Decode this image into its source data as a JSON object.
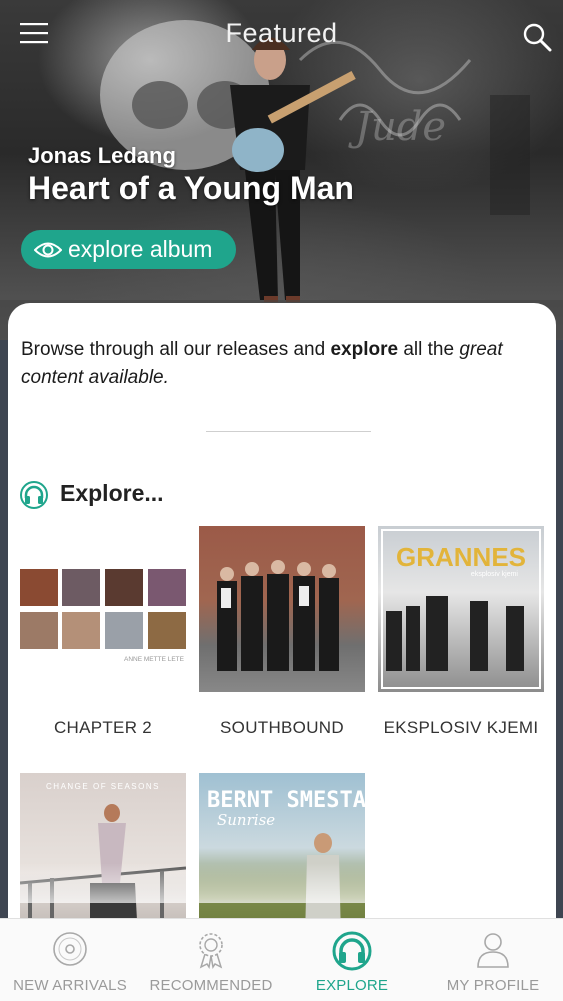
{
  "header": {
    "title": "Featured",
    "menu_icon": "hamburger-menu-icon",
    "search_icon": "search-icon"
  },
  "featured": {
    "artist": "Jonas Ledang",
    "album": "Heart of a Young Man",
    "button_label": "explore album"
  },
  "intro": {
    "part1": "Browse through all our releases and ",
    "bold": "explore",
    "part2": " all the ",
    "italic1": "great",
    "italic2": "content available",
    "end": "."
  },
  "section": {
    "title": "Explore..."
  },
  "albums": [
    {
      "title": "CHAPTER 2",
      "cover_caption": "ANNE METTE LETE"
    },
    {
      "title": "SOUTHBOUND"
    },
    {
      "title": "EKSPLOSIV KJEMI",
      "cover_title": "GRANNES",
      "cover_subtitle": "eksplosiv kjemi"
    },
    {
      "cover_caption": "CHANGE OF SEASONS"
    },
    {
      "cover_title": "BERNT SMESTAD",
      "cover_subtitle": "Sunrise"
    }
  ],
  "tabs": [
    {
      "label": "NEW ARRIVALS",
      "icon": "vinyl-disc-icon"
    },
    {
      "label": "RECOMMENDED",
      "icon": "award-ribbon-icon"
    },
    {
      "label": "EXPLORE",
      "icon": "headphones-icon",
      "active": true
    },
    {
      "label": "MY PROFILE",
      "icon": "user-profile-icon"
    }
  ],
  "colors": {
    "accent": "#1fa58c",
    "tab_inactive": "#9a9a9a"
  }
}
